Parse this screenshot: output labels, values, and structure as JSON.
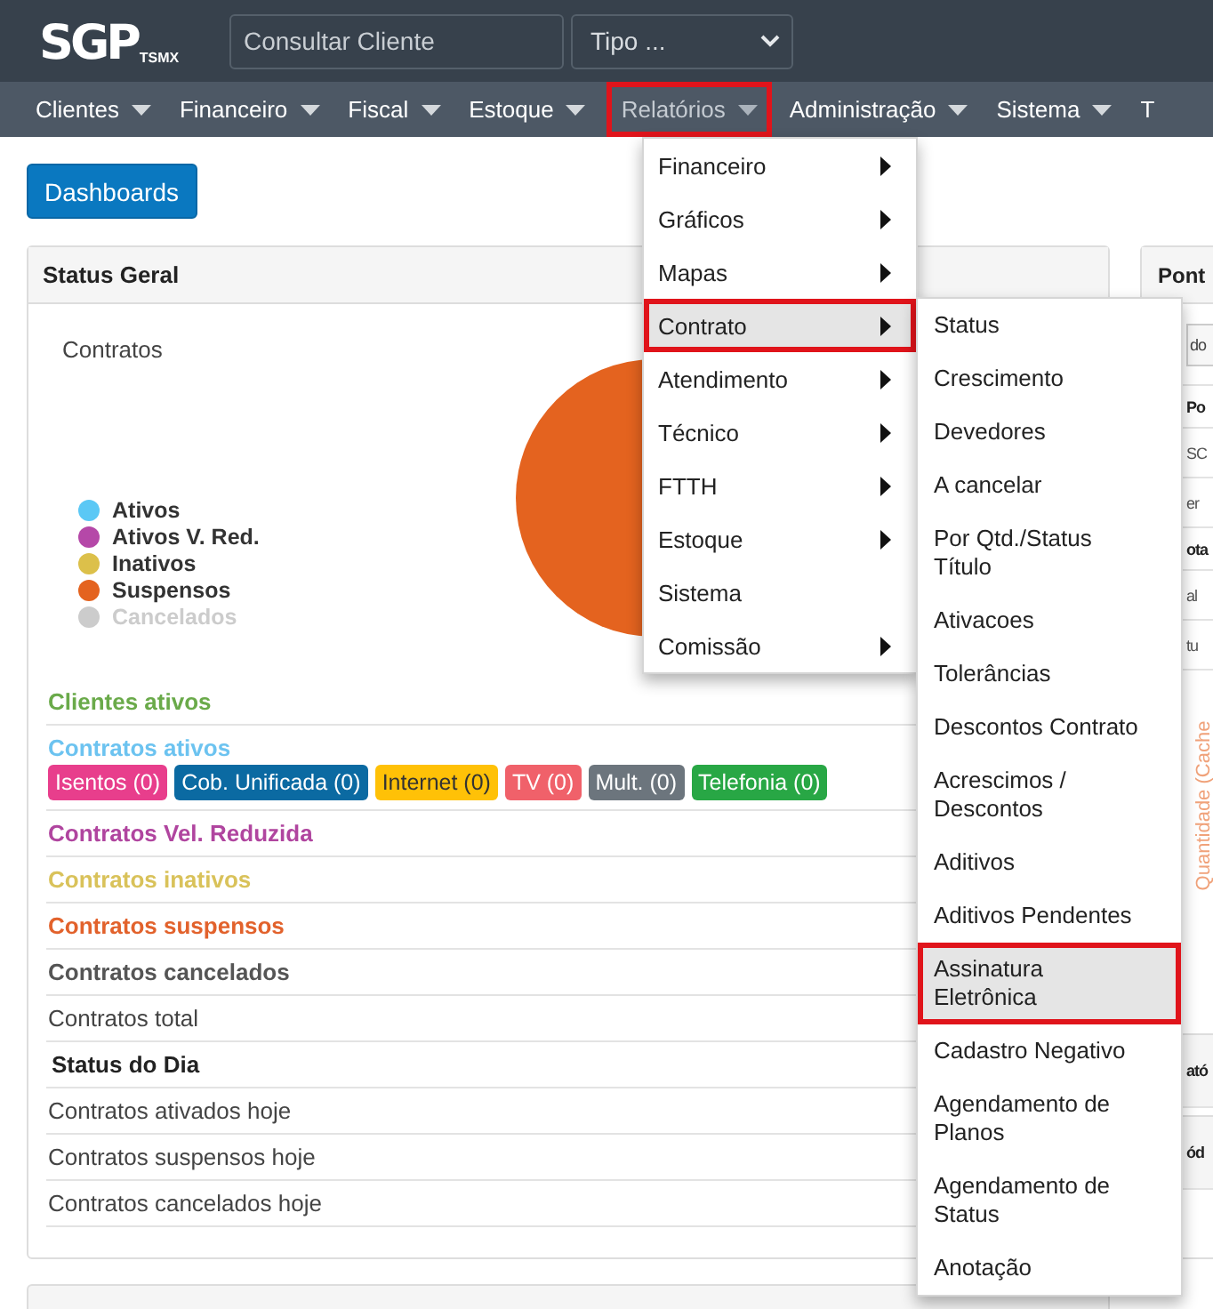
{
  "header": {
    "logo": {
      "main": "SGP",
      "sub": "TSMX"
    },
    "search": {
      "placeholder": "Consultar Cliente"
    },
    "type_select": {
      "value": "Tipo ..."
    }
  },
  "nav": [
    {
      "label": "Clientes",
      "caret": true,
      "selected": false
    },
    {
      "label": "Financeiro",
      "caret": true,
      "selected": false
    },
    {
      "label": "Fiscal",
      "caret": true,
      "selected": false
    },
    {
      "label": "Estoque",
      "caret": true,
      "selected": false
    },
    {
      "label": "Relatórios",
      "caret": true,
      "selected": true
    },
    {
      "label": "Administração",
      "caret": true,
      "selected": false
    },
    {
      "label": "Sistema",
      "caret": true,
      "selected": false
    },
    {
      "label": "T",
      "caret": false,
      "selected": false
    }
  ],
  "menu": [
    {
      "label": "Financeiro",
      "submenu": true,
      "selected": false
    },
    {
      "label": "Gráficos",
      "submenu": true,
      "selected": false
    },
    {
      "label": "Mapas",
      "submenu": true,
      "selected": false
    },
    {
      "label": "Contrato",
      "submenu": true,
      "selected": true
    },
    {
      "label": "Atendimento",
      "submenu": true,
      "selected": false
    },
    {
      "label": "Técnico",
      "submenu": true,
      "selected": false
    },
    {
      "label": "FTTH",
      "submenu": true,
      "selected": false
    },
    {
      "label": "Estoque",
      "submenu": true,
      "selected": false
    },
    {
      "label": "Sistema",
      "submenu": false,
      "selected": false
    },
    {
      "label": "Comissão",
      "submenu": true,
      "selected": false
    }
  ],
  "submenu": [
    {
      "label": "Status",
      "selected": false
    },
    {
      "label": "Crescimento",
      "selected": false
    },
    {
      "label": "Devedores",
      "selected": false
    },
    {
      "label": "A cancelar",
      "selected": false
    },
    {
      "label": "Por Qtd./Status Título",
      "selected": false
    },
    {
      "label": "Ativacoes",
      "selected": false
    },
    {
      "label": "Tolerâncias",
      "selected": false
    },
    {
      "label": "Descontos Contrato",
      "selected": false
    },
    {
      "label": "Acrescimos / Descontos",
      "selected": false
    },
    {
      "label": "Aditivos",
      "selected": false
    },
    {
      "label": "Aditivos Pendentes",
      "selected": false
    },
    {
      "label": "Assinatura Eletrônica",
      "selected": true
    },
    {
      "label": "Cadastro Negativo",
      "selected": false
    },
    {
      "label": "Agendamento de Planos",
      "selected": false
    },
    {
      "label": "Agendamento de Status",
      "selected": false
    },
    {
      "label": "Anotação",
      "selected": false
    }
  ],
  "dashboards_button": "Dashboards",
  "status_panel": {
    "title": "Status Geral",
    "chart_title": "Contratos",
    "legend": [
      {
        "label": "Ativos",
        "color": "#5bc8f5",
        "hidden": false
      },
      {
        "label": "Ativos V. Red.",
        "color": "#b548a8",
        "hidden": false
      },
      {
        "label": "Inativos",
        "color": "#dcc04a",
        "hidden": false
      },
      {
        "label": "Suspensos",
        "color": "#e4631f",
        "hidden": false
      },
      {
        "label": "Cancelados",
        "color": "#cccccc",
        "hidden": true
      }
    ],
    "rows": [
      {
        "kind": "highlight",
        "label": "Clientes ativos",
        "color": "#6aaa4a"
      },
      {
        "kind": "highlight",
        "label": "Contratos ativos",
        "color": "#6cc3f0",
        "badges": [
          {
            "label": "Isentos (0)",
            "color": "#e83e8c"
          },
          {
            "label": "Cob. Unificada (0)",
            "color": "#0b6aa2"
          },
          {
            "label": "Internet (0)",
            "color": "#ffc107"
          },
          {
            "label": "TV (0)",
            "color": "#f0616a"
          },
          {
            "label": "Mult. (0)",
            "color": "#6c757d"
          },
          {
            "label": "Telefonia (0)",
            "color": "#28a745"
          }
        ]
      },
      {
        "kind": "highlight",
        "label": "Contratos Vel. Reduzida",
        "color": "#b0459f"
      },
      {
        "kind": "highlight",
        "label": "Contratos inativos",
        "color": "#d9c25a"
      },
      {
        "kind": "highlight",
        "label": "Contratos suspensos",
        "color": "#e2622c"
      },
      {
        "kind": "highlight",
        "label": "Contratos cancelados",
        "color": "#555555"
      },
      {
        "kind": "plain",
        "label": "Contratos total"
      },
      {
        "kind": "heading",
        "label": "Status do Dia"
      },
      {
        "kind": "plain",
        "label": "Contratos ativados hoje"
      },
      {
        "kind": "plain",
        "label": "Contratos suspensos hoje"
      },
      {
        "kind": "plain",
        "label": "Contratos cancelados hoje"
      }
    ]
  },
  "side_panel": {
    "title": "Pont",
    "rows": [
      {
        "kind": "field",
        "text": "do"
      },
      {
        "kind": "bold",
        "text": "Po"
      },
      {
        "kind": "plain",
        "text": "SC"
      },
      {
        "kind": "plain",
        "text": "er"
      },
      {
        "kind": "bold",
        "text": "ota"
      },
      {
        "kind": "plain",
        "text": "al"
      },
      {
        "kind": "plain",
        "text": "tu"
      },
      {
        "kind": "vertical",
        "text": "Quantidade (Cache"
      },
      {
        "kind": "header",
        "text": "ató"
      },
      {
        "kind": "header",
        "text": "ód"
      }
    ]
  }
}
